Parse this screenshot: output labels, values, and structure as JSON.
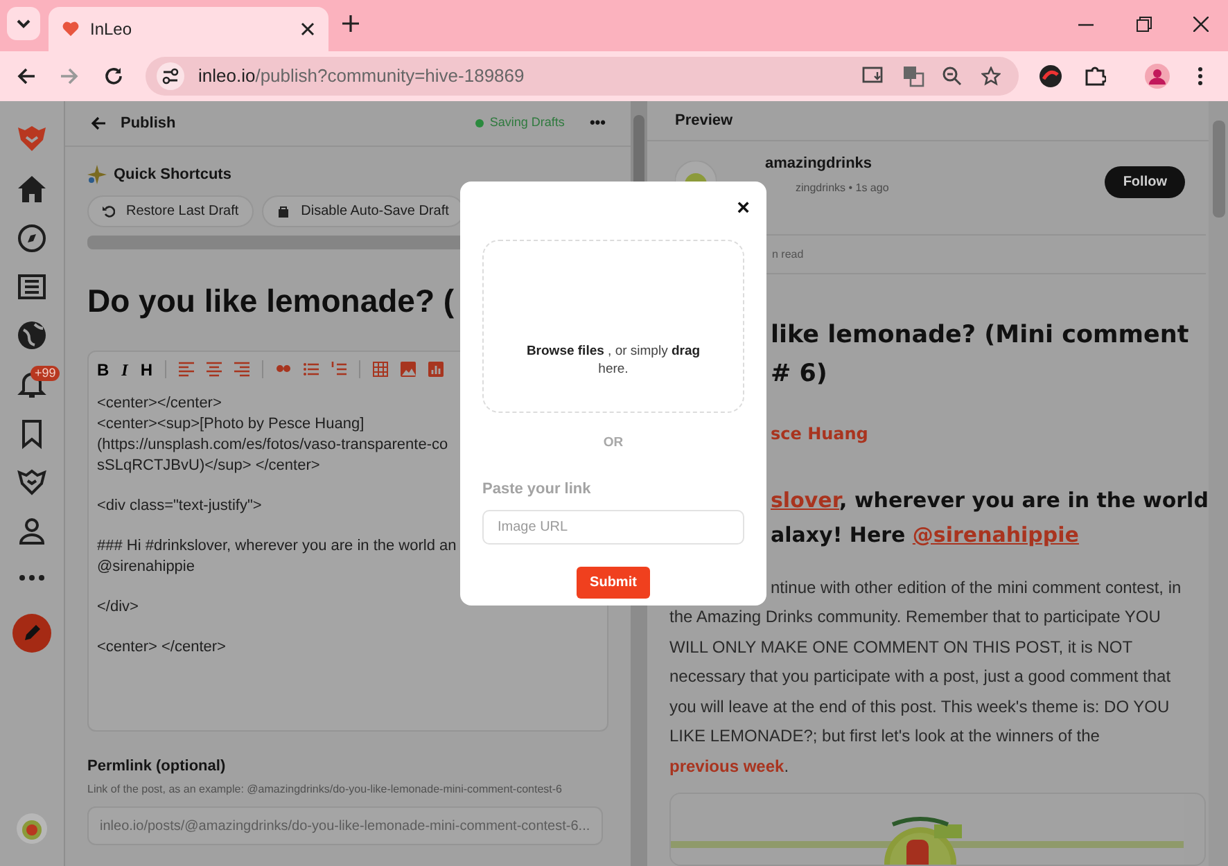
{
  "browser": {
    "tab_title": "InLeo",
    "url_host": "inleo.io",
    "url_path": "/publish?community=hive-189869"
  },
  "sidebar": {
    "notification_badge": "+99"
  },
  "editor": {
    "header_title": "Publish",
    "save_status": "Saving Drafts",
    "menu": "•••",
    "shortcuts_title": "Quick Shortcuts",
    "shortcuts": [
      "Restore Last Draft",
      "Disable Auto-Save Draft"
    ],
    "title": "Do you like lemonade? (",
    "format_letters": [
      "B",
      "I",
      "H"
    ],
    "body_blocks": [
      [
        "<center></center>",
        "<center><sup>[Photo by Pesce Huang]",
        "(https://unsplash.com/es/fotos/vaso-transparente-co",
        "sSLqRCTJBvU)</sup> </center>"
      ],
      [
        "<div class=\"text-justify\">"
      ],
      [
        "### Hi #drinkslover, wherever you are in the world an",
        "@sirenahippie"
      ],
      [
        "</div>"
      ],
      [
        "<center> </center>"
      ]
    ],
    "permlink_label": "Permlink (optional)",
    "permlink_hint": "Link of the post, as an example: @amazingdrinks/do-you-like-lemonade-mini-comment-contest-6",
    "permlink_placeholder": "inleo.io/posts/@amazingdrinks/do-you-like-lemonade-mini-comment-contest-6..."
  },
  "preview": {
    "header": "Preview",
    "author": "amazingdrinks",
    "author_meta": "zingdrinks • 1s ago",
    "follow": "Follow",
    "read_time": "n read",
    "title_lines": [
      "like lemonade? (Mini comment",
      "# 6)"
    ],
    "photo_credit": "sce Huang",
    "heading_lines": [
      {
        "link": "slover",
        "after": ", wherever you are in the world"
      },
      {
        "before": "alaxy! Here ",
        "link": "@sirenahippie"
      }
    ],
    "paragraph": {
      "before": "ntinue with other edition of the mini comment contest, in the Amazing Drinks community. Remember that to participate YOU WILL ONLY MAKE ONE COMMENT ON THIS POST, it is NOT necessary that you participate with a post, just a good comment that you will leave at the end of this post. This week's theme is: DO YOU LIKE LEMONADE?; but first let's look at the winners of the ",
      "link": "previous week",
      "after": "."
    }
  },
  "modal": {
    "drop_text": "**Browse files** , or simply **drag** here.",
    "separator": "OR",
    "link_label": "Paste your link",
    "link_placeholder": "Image URL",
    "submit": "Submit",
    "close": "×"
  }
}
